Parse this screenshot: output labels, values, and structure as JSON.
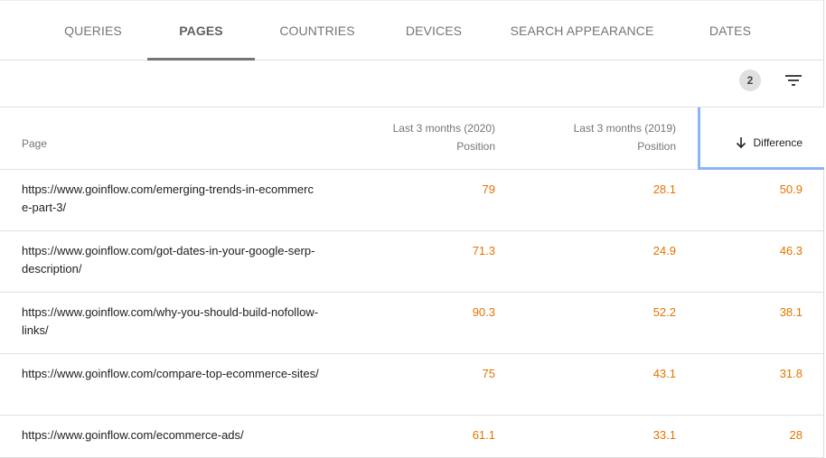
{
  "tabs": [
    {
      "label": "QUERIES",
      "active": false
    },
    {
      "label": "PAGES",
      "active": true
    },
    {
      "label": "COUNTRIES",
      "active": false
    },
    {
      "label": "DEVICES",
      "active": false
    },
    {
      "label": "SEARCH APPEARANCE",
      "active": false
    },
    {
      "label": "DATES",
      "active": false
    }
  ],
  "toolbar": {
    "active_filter_count": "2",
    "filter_icon": "filter-list-icon"
  },
  "table": {
    "columns": {
      "page": "Page",
      "col1_line1": "Last 3 months (2020)",
      "col1_line2": "Position",
      "col2_line1": "Last 3 months (2019)",
      "col2_line2": "Position",
      "difference": "Difference",
      "sort_icon": "arrow-downward-icon"
    },
    "rows": [
      {
        "page": "https://www.goinflow.com/emerging-trends-in-ecommerce-part-3/",
        "pos_2020": "79",
        "pos_2019": "28.1",
        "difference": "50.9"
      },
      {
        "page": "https://www.goinflow.com/got-dates-in-your-google-serp-description/",
        "pos_2020": "71.3",
        "pos_2019": "24.9",
        "difference": "46.3"
      },
      {
        "page": "https://www.goinflow.com/why-you-should-build-nofollow-links/",
        "pos_2020": "90.3",
        "pos_2019": "52.2",
        "difference": "38.1"
      },
      {
        "page": "https://www.goinflow.com/compare-top-ecommerce-sites/",
        "pos_2020": "75",
        "pos_2019": "43.1",
        "difference": "31.8"
      },
      {
        "page": "https://www.goinflow.com/ecommerce-ads/",
        "pos_2020": "61.1",
        "pos_2019": "33.1",
        "difference": "28"
      }
    ]
  },
  "colors": {
    "value_text": "#e37400",
    "sort_highlight": "#8ab4f8",
    "tab_indicator": "#757575"
  }
}
